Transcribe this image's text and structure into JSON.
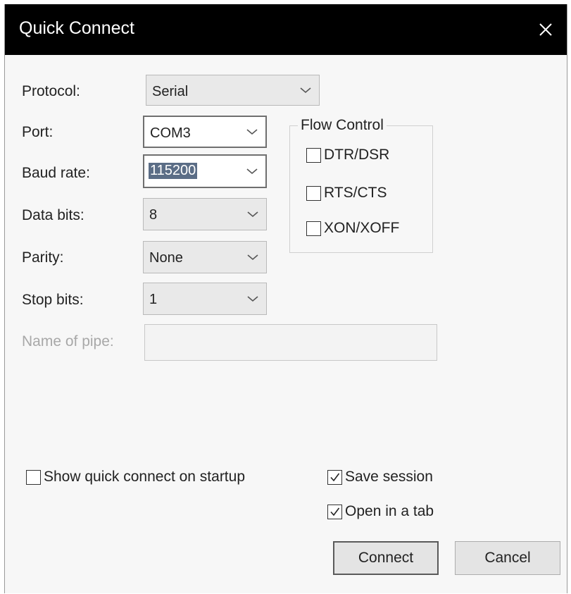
{
  "window": {
    "title": "Quick Connect"
  },
  "fields": {
    "protocol": {
      "label": "Protocol:",
      "value": "Serial"
    },
    "port": {
      "label": "Port:",
      "value": "COM3"
    },
    "baud_rate": {
      "label": "Baud rate:",
      "value": "115200"
    },
    "data_bits": {
      "label": "Data bits:",
      "value": "8"
    },
    "parity": {
      "label": "Parity:",
      "value": "None"
    },
    "stop_bits": {
      "label": "Stop bits:",
      "value": "1"
    },
    "name_of_pipe": {
      "label": "Name of pipe:",
      "value": ""
    }
  },
  "flow_control": {
    "title": "Flow Control",
    "options": [
      {
        "label": "DTR/DSR",
        "checked": false
      },
      {
        "label": "RTS/CTS",
        "checked": false
      },
      {
        "label": "XON/XOFF",
        "checked": false
      }
    ]
  },
  "options": {
    "show_on_startup": {
      "label": "Show quick connect on startup",
      "checked": false
    },
    "save_session": {
      "label": "Save session",
      "checked": true
    },
    "open_in_tab": {
      "label": "Open in a tab",
      "checked": true
    }
  },
  "buttons": {
    "connect": "Connect",
    "cancel": "Cancel"
  },
  "icons": {
    "close": "close-icon",
    "dropdown": "chevron-down-icon",
    "checkmark": "checkmark-icon"
  }
}
